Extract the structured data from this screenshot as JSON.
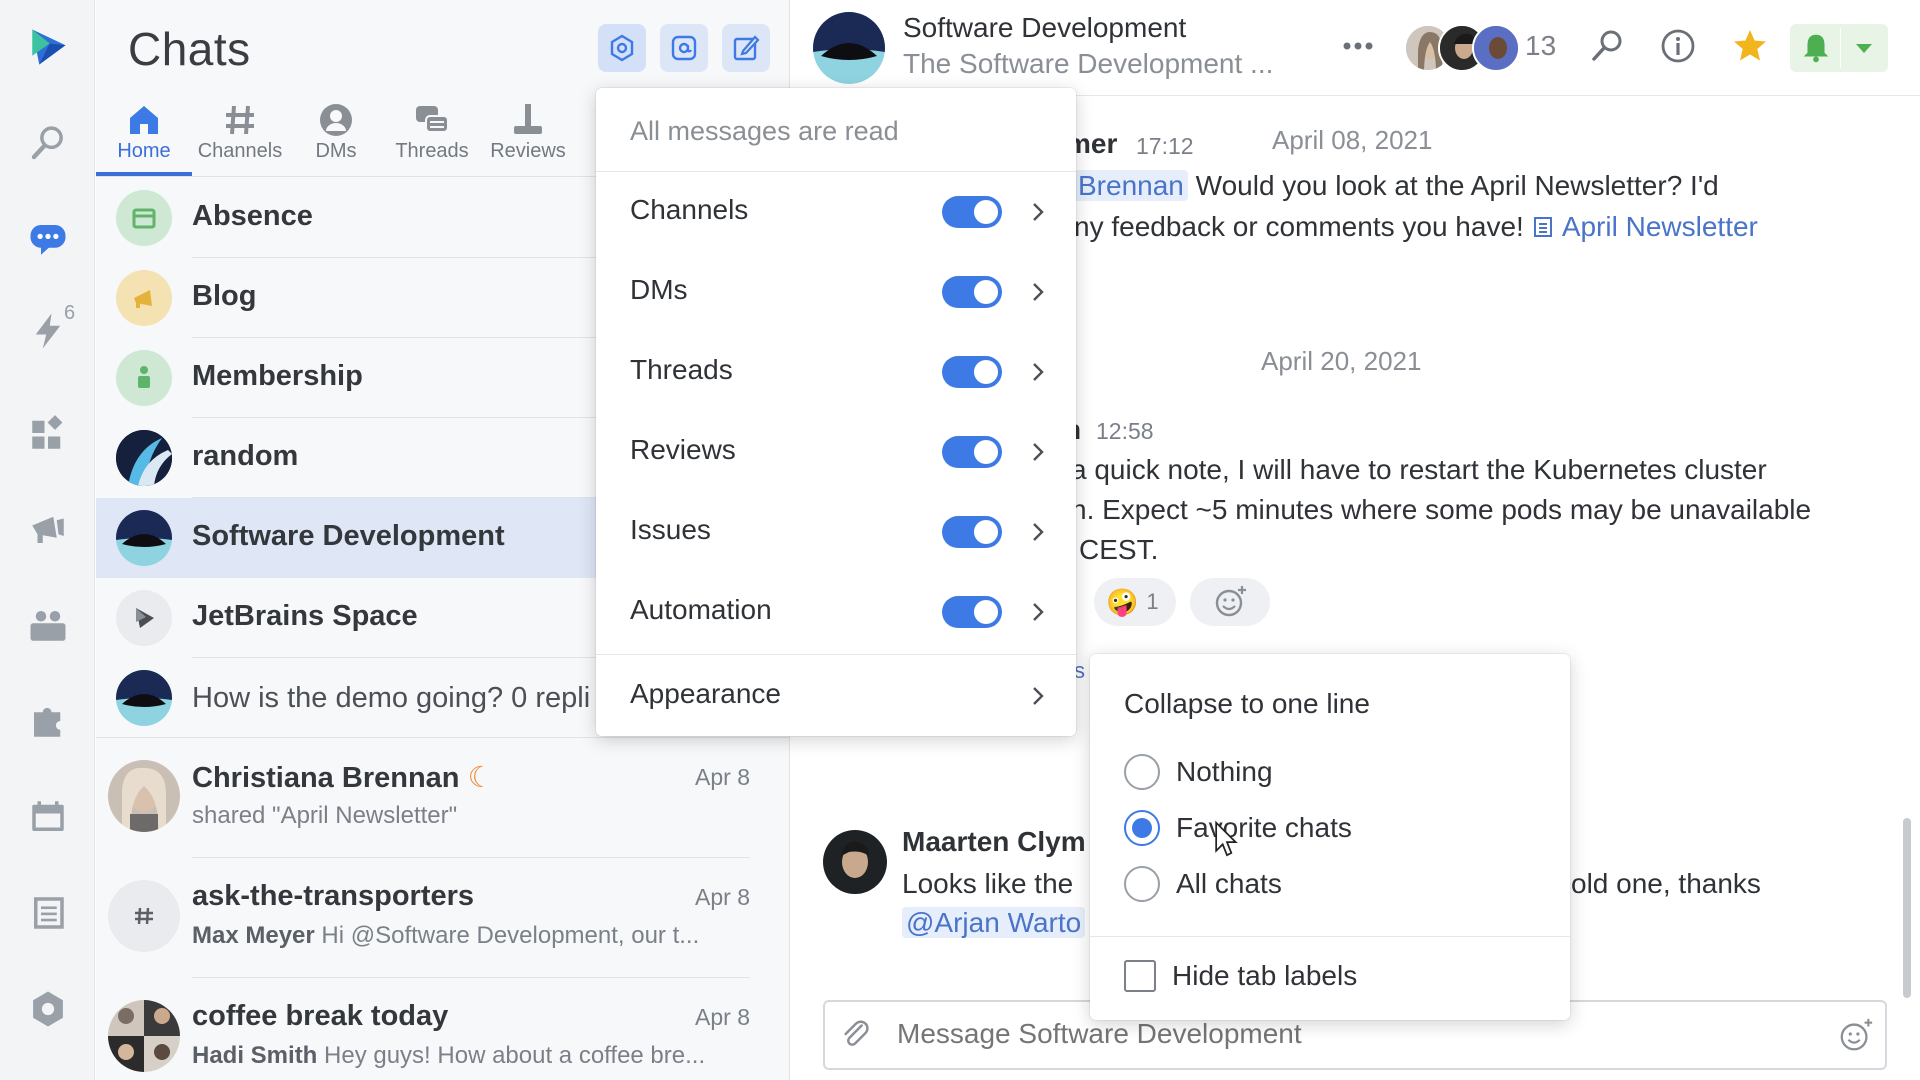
{
  "chats_panel": {
    "title": "Chats",
    "tabs": [
      {
        "label": "Home"
      },
      {
        "label": "Channels"
      },
      {
        "label": "DMs"
      },
      {
        "label": "Threads"
      },
      {
        "label": "Reviews"
      }
    ],
    "channels": [
      {
        "name": "Absence"
      },
      {
        "name": "Blog"
      },
      {
        "name": "Membership"
      },
      {
        "name": "random"
      },
      {
        "name": "Software Development"
      },
      {
        "name": "JetBrains Space"
      }
    ],
    "thread_preview": "How is the demo going? 0 repli",
    "conversations": [
      {
        "name": "Christiana Brennan",
        "date": "Apr 8",
        "preview": "shared \"April Newsletter\""
      },
      {
        "name": "ask-the-transporters",
        "date": "Apr 8",
        "sender": "Max Meyer",
        "preview": "Hi @Software Development, our t..."
      },
      {
        "name": "coffee break today",
        "date": "Apr 8",
        "sender": "Hadi Smith",
        "preview": "Hey guys! How about a coffee bre..."
      }
    ]
  },
  "rail": {
    "badge_count": "6"
  },
  "channel_header": {
    "title": "Software Development",
    "description": "The Software Development ...",
    "member_count": "13"
  },
  "messages": {
    "date1": "April 08, 2021",
    "msg1_author_fragment": "mer",
    "msg1_time": "17:12",
    "msg1_mention": "Brennan",
    "msg1_line1": "Would you look at the April Newsletter? I'd",
    "msg1_line2": "ny feedback or comments you have!",
    "msg1_link": "April Newsletter",
    "date2": "April 20, 2021",
    "msg2_author_fragment": "n",
    "msg2_time": "12:58",
    "msg2_line1": "a quick note, I will have to restart the Kubernetes cluster",
    "msg2_line2": "n. Expect ~5 minutes where some pods may be unavailable",
    "msg2_line3": "CEST.",
    "reaction_count": "1",
    "threads_fragment": "s",
    "msg3_author": "Maarten Clym",
    "msg3_line1_start": "Looks like the",
    "msg3_line1_end": "old one, thanks",
    "msg3_mention": "@Arjan Warto"
  },
  "composer": {
    "placeholder": "Message Software Development"
  },
  "popover": {
    "status": "All messages are read",
    "items": [
      {
        "label": "Channels",
        "enabled": true
      },
      {
        "label": "DMs",
        "enabled": true
      },
      {
        "label": "Threads",
        "enabled": true
      },
      {
        "label": "Reviews",
        "enabled": true
      },
      {
        "label": "Issues",
        "enabled": true
      },
      {
        "label": "Automation",
        "enabled": true
      }
    ],
    "appearance_label": "Appearance"
  },
  "submenu": {
    "title": "Collapse to one line",
    "options": [
      {
        "label": "Nothing",
        "checked": false
      },
      {
        "label": "Favorite chats",
        "checked": true
      },
      {
        "label": "All chats",
        "checked": false
      }
    ],
    "checkbox_label": "Hide tab labels",
    "checkbox_checked": false
  },
  "colors": {
    "accent": "#3d7ae6",
    "selected_row": "#dfe7f7",
    "star": "#f2b51d",
    "bell": "#4caf50"
  }
}
